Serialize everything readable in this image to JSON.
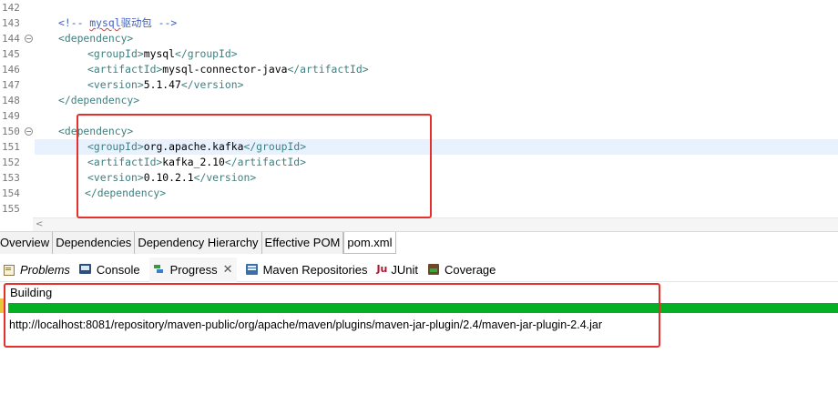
{
  "editor": {
    "lines": [
      {
        "num": "142",
        "indent": 0,
        "tokens": []
      },
      {
        "num": "143",
        "indent": 1,
        "tokens": [
          {
            "t": "<!-- ",
            "c": "comment"
          },
          {
            "t": "mysql",
            "c": "comment squiggle"
          },
          {
            "t": "驱动包 -->",
            "c": "comment"
          }
        ]
      },
      {
        "num": "144",
        "indent": 1,
        "fold": true,
        "tokens": [
          {
            "t": "<dependency>",
            "c": "tag"
          }
        ]
      },
      {
        "num": "145",
        "indent": 2,
        "tokens": [
          {
            "t": "<groupId>",
            "c": "tag"
          },
          {
            "t": "mysql",
            "c": "txt"
          },
          {
            "t": "</groupId>",
            "c": "tag"
          }
        ]
      },
      {
        "num": "146",
        "indent": 2,
        "tokens": [
          {
            "t": "<artifactId>",
            "c": "tag"
          },
          {
            "t": "mysql-connector-java",
            "c": "txt"
          },
          {
            "t": "</artifactId>",
            "c": "tag"
          }
        ]
      },
      {
        "num": "147",
        "indent": 2,
        "tokens": [
          {
            "t": "<version>",
            "c": "tag"
          },
          {
            "t": "5.1.47",
            "c": "txt"
          },
          {
            "t": "</version>",
            "c": "tag"
          }
        ]
      },
      {
        "num": "148",
        "indent": 1,
        "tokens": [
          {
            "t": "</dependency>",
            "c": "tag"
          }
        ]
      },
      {
        "num": "149",
        "indent": 0,
        "tokens": []
      },
      {
        "num": "150",
        "indent": 1,
        "fold": true,
        "tokens": [
          {
            "t": "<dependency>",
            "c": "tag"
          }
        ]
      },
      {
        "num": "151",
        "indent": 2,
        "current": true,
        "tokens": [
          {
            "t": "<groupId>",
            "c": "tag"
          },
          {
            "t": "org.apache.kafka",
            "c": "txt"
          },
          {
            "t": "</groupId>",
            "c": "tag"
          }
        ]
      },
      {
        "num": "152",
        "indent": 2,
        "tokens": [
          {
            "t": "<artifactId>",
            "c": "tag"
          },
          {
            "t": "kafka_2.10",
            "c": "txt"
          },
          {
            "t": "</artifactId>",
            "c": "tag"
          }
        ]
      },
      {
        "num": "153",
        "indent": 2,
        "tokens": [
          {
            "t": "<version>",
            "c": "tag"
          },
          {
            "t": "0.10.2.1",
            "c": "txt"
          },
          {
            "t": "</version>",
            "c": "tag"
          }
        ]
      },
      {
        "num": "154",
        "indent": 0.5,
        "tokens": [
          {
            "t": "</dependency>",
            "c": "tag"
          }
        ]
      },
      {
        "num": "155",
        "indent": 0,
        "tokens": []
      }
    ],
    "scroll_left_glyph": "<"
  },
  "pom_tabs": [
    {
      "label": "Overview",
      "state": "inactive"
    },
    {
      "label": "Dependencies",
      "state": "inactive"
    },
    {
      "label": "Dependency Hierarchy",
      "state": "inactive"
    },
    {
      "label": "Effective POM",
      "state": "inactive"
    },
    {
      "label": "pom.xml",
      "state": "active"
    }
  ],
  "views": {
    "problems": {
      "label": "Problems",
      "icon": "problems-icon"
    },
    "console": {
      "label": "Console",
      "icon": "console-icon"
    },
    "progress": {
      "label": "Progress",
      "icon": "progress-icon",
      "close": "✕"
    },
    "maven_repos": {
      "label": "Maven Repositories",
      "icon": "maven-repositories-icon"
    },
    "junit": {
      "label": "JUnit",
      "icon_text": "Ju"
    },
    "coverage": {
      "label": "Coverage",
      "icon": "coverage-icon"
    }
  },
  "progress": {
    "job_name": "Building",
    "fraction": 1.0,
    "bar_color": "#06b025",
    "detail": "http://localhost:8081/repository/maven-public/org/apache/maven/plugins/maven-jar-plugin/2.4/maven-jar-plugin-2.4.jar"
  },
  "highlight_color": "#e5302b"
}
